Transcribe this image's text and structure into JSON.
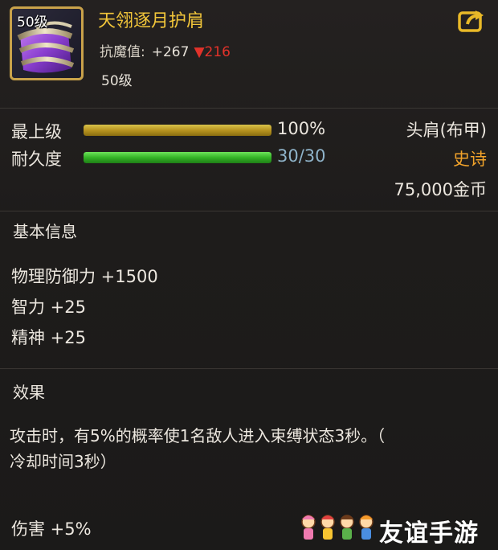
{
  "header": {
    "icon_level": "50级",
    "item_name": "天翎逐月护肩",
    "resist_label": "抗魔值:",
    "resist_plus": "+267",
    "resist_down_arrow": "▼",
    "resist_down": "216",
    "item_level": "50级",
    "share_icon": "share-export-icon"
  },
  "bars": {
    "upgrade_label": "最上级",
    "upgrade_value_text": "100%",
    "upgrade_fraction": 1.0,
    "durability_label": "耐久度",
    "durability_value_text": "30/30",
    "durability_fraction": 1.0
  },
  "info": {
    "slot": "头肩(布甲)",
    "quality": "史诗",
    "price": "75,000金币"
  },
  "basic": {
    "title": "基本信息",
    "stats": [
      "物理防御力 +1500",
      "智力 +25",
      "精神 +25"
    ]
  },
  "effect": {
    "title": "效果",
    "line1": "攻击时，有5%的概率使1名敌人进入束缚状态3秒。（",
    "line2": "冷却时间3秒）",
    "damage": "伤害 +5%"
  },
  "watermark": {
    "text": "友谊手游"
  },
  "colors": {
    "name_gold": "#f2c63a",
    "quality_orange": "#f2a32a",
    "down_red": "#e2322a",
    "durability_blue": "#8fb3c9"
  }
}
